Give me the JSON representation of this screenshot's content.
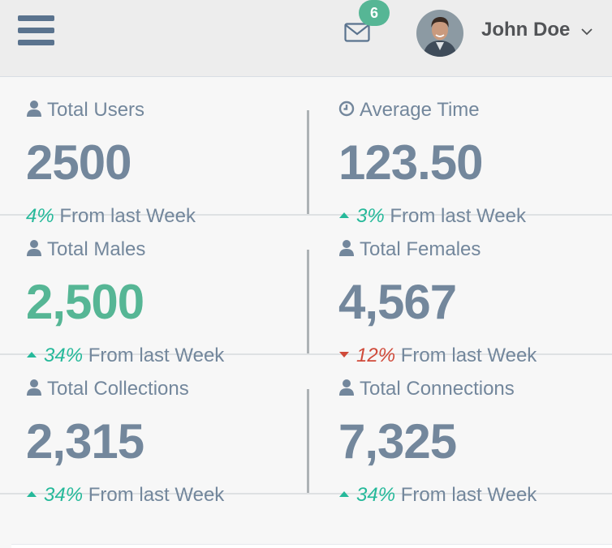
{
  "header": {
    "mail_count": "6",
    "user_name": "John Doe",
    "colors": {
      "badge": "#56b695",
      "icon": "#5a738e"
    }
  },
  "stats": [
    {
      "label": "Total Users",
      "icon": "user-icon",
      "value": "2500",
      "value_color": "#73879c",
      "trend": "none",
      "pct": "4%",
      "pct_color": "#26b99a",
      "foot_text": " From last Week"
    },
    {
      "label": "Average Time",
      "icon": "clock-icon",
      "value": "123.50",
      "value_color": "#73879c",
      "trend": "up",
      "pct": "3%",
      "pct_color": "#26b99a",
      "foot_text": " From last Week"
    },
    {
      "label": "Total Males",
      "icon": "user-icon",
      "value": "2,500",
      "value_color": "#56b695",
      "trend": "up",
      "pct": "34%",
      "pct_color": "#26b99a",
      "foot_text": " From last Week"
    },
    {
      "label": "Total Females",
      "icon": "user-icon",
      "value": "4,567",
      "value_color": "#73879c",
      "trend": "down",
      "pct": "12%",
      "pct_color": "#d04a3a",
      "foot_text": " From last Week"
    },
    {
      "label": "Total Collections",
      "icon": "user-icon",
      "value": "2,315",
      "value_color": "#73879c",
      "trend": "up",
      "pct": "34%",
      "pct_color": "#26b99a",
      "foot_text": " From last Week"
    },
    {
      "label": "Total Connections",
      "icon": "user-icon",
      "value": "7,325",
      "value_color": "#73879c",
      "trend": "up",
      "pct": "34%",
      "pct_color": "#26b99a",
      "foot_text": " From last Week"
    }
  ]
}
